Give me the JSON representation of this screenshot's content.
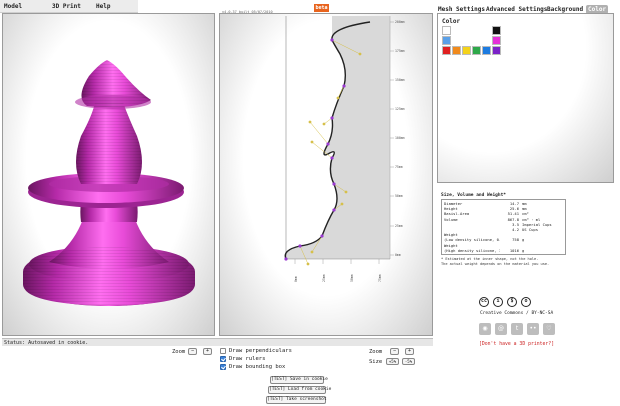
{
  "menu": [
    {
      "label": "Model"
    },
    {
      "label": "3D Print"
    },
    {
      "label": "Help"
    }
  ],
  "version": "v4.0.37 built 05/07/2010",
  "beta": "beta",
  "tabs": [
    {
      "label": "Mesh Settings"
    },
    {
      "label": "Advanced Settings"
    },
    {
      "label": "Background"
    },
    {
      "label": "Color"
    }
  ],
  "color_panel": {
    "title": "Color",
    "swatches": [
      "#ffffff",
      "#111111",
      "#5aa0e8",
      "#ffffff",
      "#e52fd8",
      "#e02020",
      "#f08a1c",
      "#f4d21a",
      "#2ea84a",
      "#1d7be0",
      "#7b22c8"
    ]
  },
  "model_color": "#e84bd8",
  "status": "Status: Autosaved in cookie.",
  "ruler": {
    "ticks": [
      "200mm",
      "175mm",
      "150mm",
      "125mm",
      "100mm",
      "75mm",
      "50mm",
      "25mm",
      "0mm"
    ],
    "bottom": [
      "0mm",
      "25mm",
      "50mm",
      "75mm"
    ]
  },
  "info": {
    "title": "Size, Volume and Weight*",
    "rows": [
      {
        "k": "Diameter",
        "v": "14.7",
        "u": "mm"
      },
      {
        "k": "Height",
        "v": "25.6",
        "u": "mm"
      },
      {
        "k": "Basisl.Area",
        "v": "51.41",
        "u": "cm²"
      },
      {
        "k": "Volume",
        "v": "867.8",
        "u": "cm³ · ml"
      },
      {
        "k": "",
        "v": "3.5",
        "u": "Imperial Cups"
      },
      {
        "k": "",
        "v": "4.2",
        "u": "US Cups"
      },
      {
        "k": "Weight",
        "v": "",
        "u": ""
      },
      {
        "k": "(Low density silicone, 0.76g/cm³)",
        "v": "758",
        "u": "g"
      },
      {
        "k": "Weight",
        "v": "",
        "u": ""
      },
      {
        "k": "(High density silicone, 1.17g/cm³)",
        "v": "1016",
        "u": "g"
      }
    ],
    "note1": "* Estimated at the inner shape, not the hole.",
    "note2": "The actual weight depends on the material you use."
  },
  "license": {
    "text": "Creative Commons / BY-NC-SA",
    "badges": [
      "cc",
      "i",
      "$",
      "o"
    ],
    "share_icons": [
      "rss-icon",
      "at-icon",
      "twitter-icon",
      "flickr-icon",
      "heart-icon"
    ],
    "no_printer": "[Don't have a 3D printer?]"
  },
  "controls_left": {
    "zoom_label": "Zoom",
    "minus": "−",
    "plus": "+",
    "perp": "Draw perpendiculars",
    "rulers": "Draw rulers",
    "bbox": "Draw bounding box",
    "perp_on": false,
    "rulers_on": true,
    "bbox_on": true
  },
  "controls_right": {
    "zoom_label": "Zoom",
    "minus": "−",
    "plus": "+",
    "size_label": "Size",
    "plus_pct": "+5%",
    "minus_pct": "-5%"
  },
  "actions": {
    "save": "[TEST] Save in cookie",
    "load": "[TEST] Load from cookie",
    "screenshot": "[TEST] Take screenshot"
  }
}
